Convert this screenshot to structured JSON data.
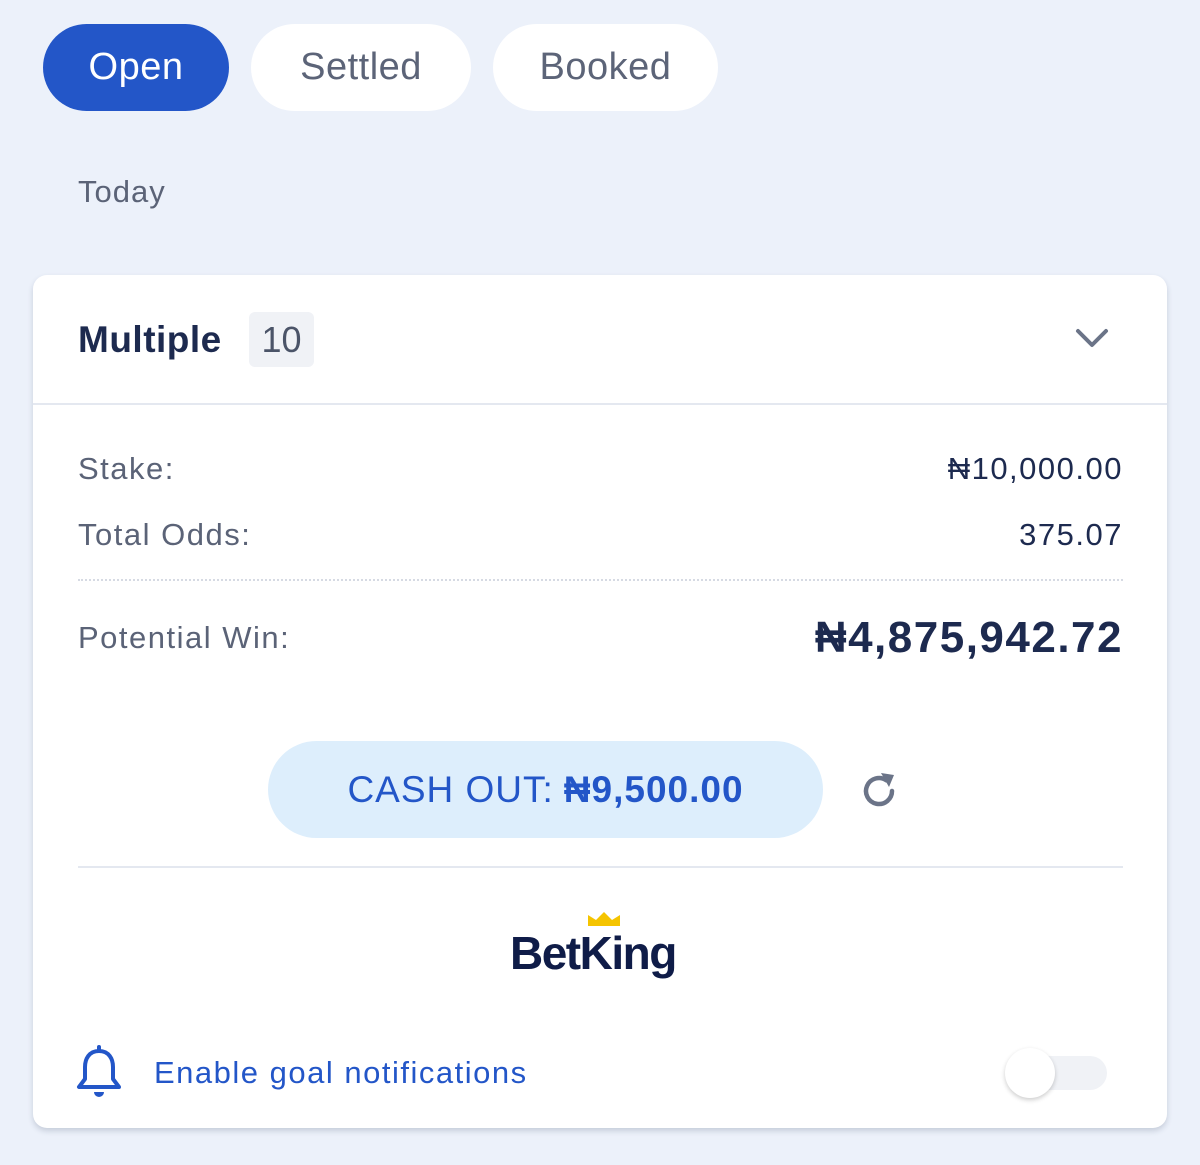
{
  "tabs": [
    {
      "label": "Open",
      "active": true
    },
    {
      "label": "Settled",
      "active": false
    },
    {
      "label": "Booked",
      "active": false
    }
  ],
  "section_label": "Today",
  "bet": {
    "type": "Multiple",
    "count": "10",
    "stake_label": "Stake:",
    "stake_value": "₦10,000.00",
    "odds_label": "Total Odds:",
    "odds_value": "375.07",
    "win_label": "Potential Win:",
    "win_value": "₦4,875,942.72"
  },
  "cashout": {
    "label": "CASH OUT:",
    "amount": "₦9,500.00"
  },
  "brand": {
    "name": "BetKing"
  },
  "notifications": {
    "label": "Enable goal notifications",
    "enabled": false
  },
  "colors": {
    "background": "#ecf1fa",
    "accent": "#2356c8",
    "text_dark": "#1d2a4f",
    "text_muted": "#5b6377",
    "cashout_bg": "#ddeefc",
    "crown": "#f5c400"
  },
  "icons": [
    "chevron-down-icon",
    "refresh-icon",
    "crown-icon",
    "bell-icon"
  ]
}
